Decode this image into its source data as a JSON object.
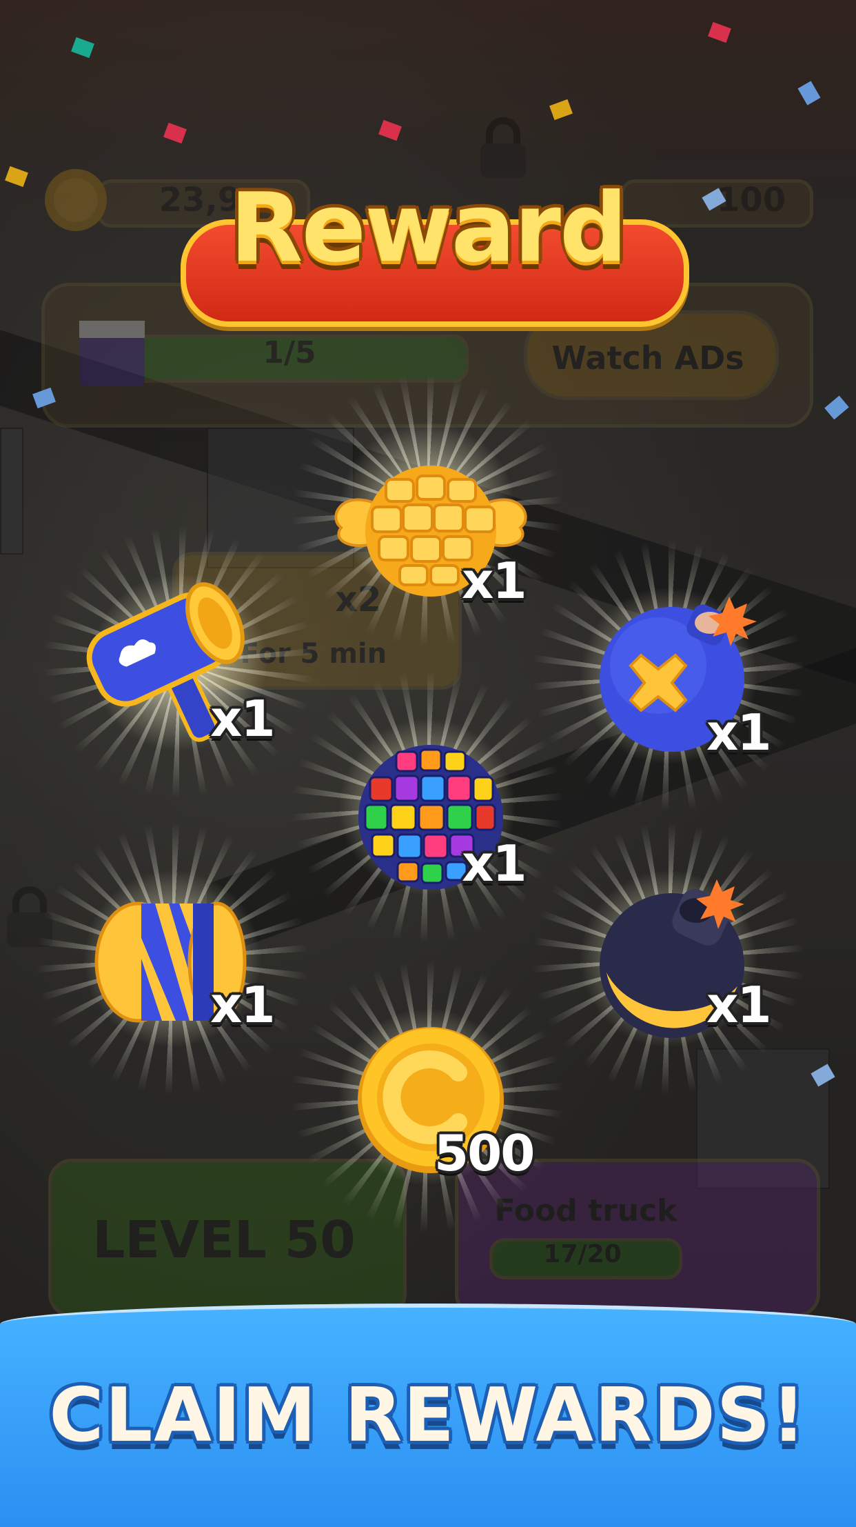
{
  "hud": {
    "coins_value": "23,9",
    "stars_value": "100",
    "video_progress": "1/5",
    "watch_ads_label": "Watch ADs",
    "boost_label": "x2",
    "boost_duration": "For 5 min",
    "level_label": "LEVEL",
    "level_number": "50",
    "event_title": "Food truck",
    "event_progress": "17/20"
  },
  "dialog": {
    "title": "Reward",
    "rewards": [
      {
        "icon": "winged-ball-icon",
        "quantity": "x1"
      },
      {
        "icon": "hammer-icon",
        "quantity": "x1"
      },
      {
        "icon": "bomb-icon",
        "quantity": "x1"
      },
      {
        "icon": "disco-ball-icon",
        "quantity": "x1"
      },
      {
        "icon": "rocket-icon",
        "quantity": "x1"
      },
      {
        "icon": "black-bomb-icon",
        "quantity": "x1"
      },
      {
        "icon": "coin-icon",
        "quantity": "500"
      }
    ]
  },
  "footer": {
    "caption": "CLAIM REWARDS!"
  },
  "colors": {
    "title_fill": "#ffe36a",
    "title_banner": "#e0361e",
    "footer_blue": "#3aa0fa",
    "coin_gold": "#f5b51d",
    "piece_blue": "#3d4fe0"
  }
}
